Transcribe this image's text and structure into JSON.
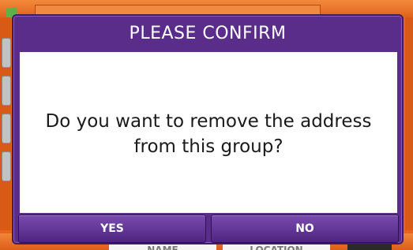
{
  "dialog": {
    "title": "PLEASE CONFIRM",
    "message": "Do you want to remove the address from this group?",
    "buttons": {
      "yes": "YES",
      "no": "NO"
    }
  },
  "background": {
    "bottom_tabs": [
      "NAME",
      "LOCATION"
    ]
  },
  "colors": {
    "dialog_purple": "#5a2d8a",
    "background_orange": "#e8641e",
    "button_purple": "#6a3a9e",
    "body_white": "#ffffff"
  }
}
